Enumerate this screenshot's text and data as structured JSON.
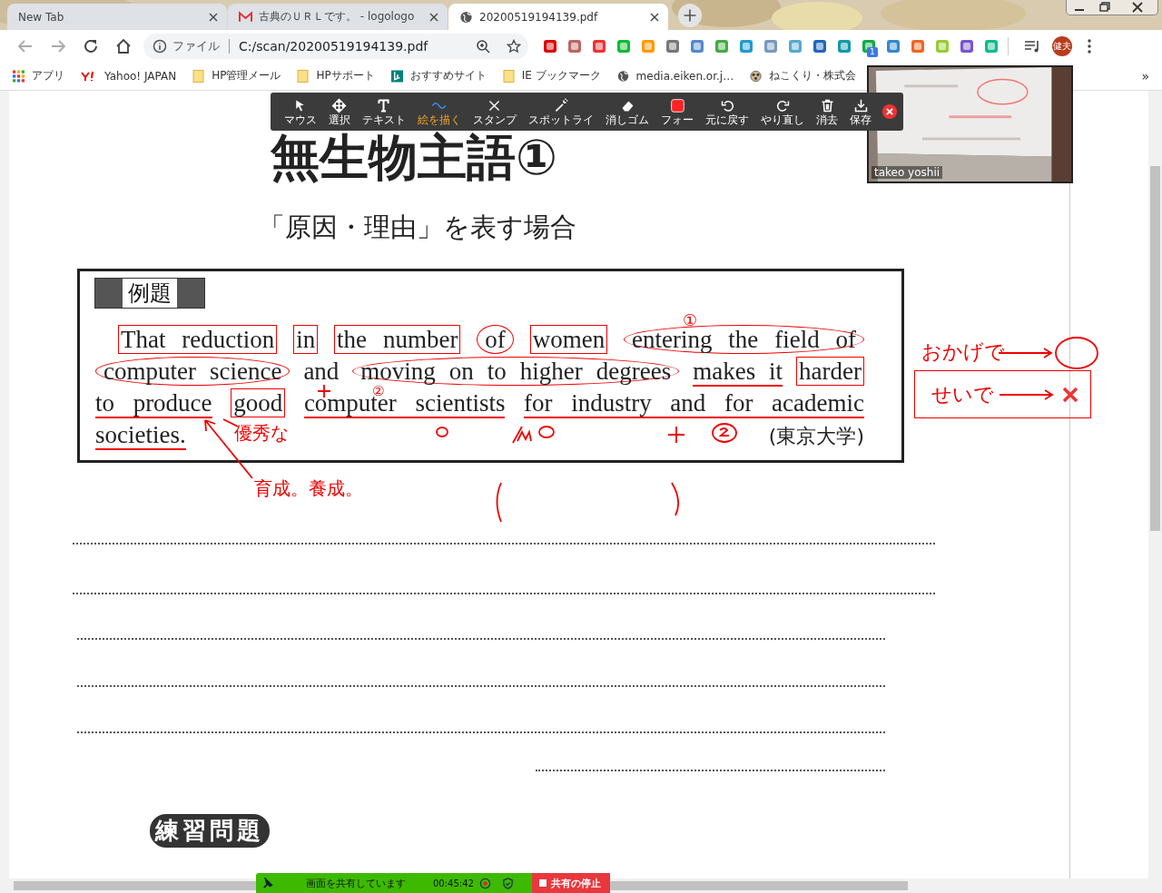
{
  "tabs": [
    {
      "title": "New Tab",
      "selected": false
    },
    {
      "title": "古典のＵＲＬです。 - logologo",
      "selected": false
    },
    {
      "title": "20200519194139.pdf",
      "selected": true
    }
  ],
  "address": {
    "scheme_label": "ファイル",
    "url": "C:/scan/20200519194139.pdf"
  },
  "extension_badge": "1",
  "profile": "健夫",
  "bookmarks": [
    {
      "label": "アプリ"
    },
    {
      "label": "Yahoo! JAPAN"
    },
    {
      "label": "HP管理メール"
    },
    {
      "label": "HPサポート"
    },
    {
      "label": "おすすめサイト"
    },
    {
      "label": "IE ブックマーク"
    },
    {
      "label": "media.eiken.or.j…"
    },
    {
      "label": "ねこくり・株式会"
    }
  ],
  "bookmarks_overflow": "»",
  "annotation_toolbar": {
    "tools": [
      {
        "label": "マウス",
        "selected": false
      },
      {
        "label": "選択",
        "selected": false
      },
      {
        "label": "テキスト",
        "selected": false
      },
      {
        "label": "絵を描く",
        "selected": true
      },
      {
        "label": "スタンプ",
        "selected": false
      },
      {
        "label": "スポットライ",
        "selected": false
      },
      {
        "label": "消しゴム",
        "selected": false
      },
      {
        "label": "フォー",
        "selected": false
      },
      {
        "label": "元に戻す",
        "selected": false
      },
      {
        "label": "やり直し",
        "selected": false
      },
      {
        "label": "消去",
        "selected": false
      },
      {
        "label": "保存",
        "selected": false
      }
    ]
  },
  "video": {
    "name": "takeo yoshii"
  },
  "document": {
    "title": "無生物主語①",
    "subtitle": "「原因・理由」を表す場合",
    "example_label": "例題",
    "lines": [
      {
        "segments": [
          {
            "text": "That reduction",
            "kind": "box"
          },
          {
            "text": "in",
            "kind": "box"
          },
          {
            "text": "the number",
            "kind": "box"
          },
          {
            "text": "of",
            "kind": "ellipse"
          },
          {
            "text": "women",
            "kind": "box"
          },
          {
            "text": "entering the field of",
            "kind": "ellipse"
          }
        ]
      },
      {
        "segments": [
          {
            "text": "computer science",
            "kind": "ellipse"
          },
          {
            "text": "and",
            "kind": "plain"
          },
          {
            "text": "moving on to higher degrees",
            "kind": "ellipse"
          },
          {
            "text": "makes it",
            "kind": "underline"
          },
          {
            "text": "harder",
            "kind": "box"
          }
        ]
      },
      {
        "segments": [
          {
            "text": "to produce",
            "kind": "underline"
          },
          {
            "text": "good",
            "kind": "box"
          },
          {
            "text": "computer scientists",
            "kind": "underline"
          },
          {
            "text": "for industry and for academic",
            "kind": "underline"
          }
        ]
      },
      {
        "segments": [
          {
            "text": "societies.",
            "kind": "underline"
          }
        ]
      }
    ],
    "source": "(東京大学)",
    "exercise_heading": "練習問題"
  },
  "notes": [
    "①",
    "②",
    "優秀な",
    "育成。養成。",
    "おかげで",
    "せいで"
  ],
  "share_bar": {
    "status": "画面を共有しています",
    "time": "00:45:42",
    "stop": "共有の停止"
  }
}
